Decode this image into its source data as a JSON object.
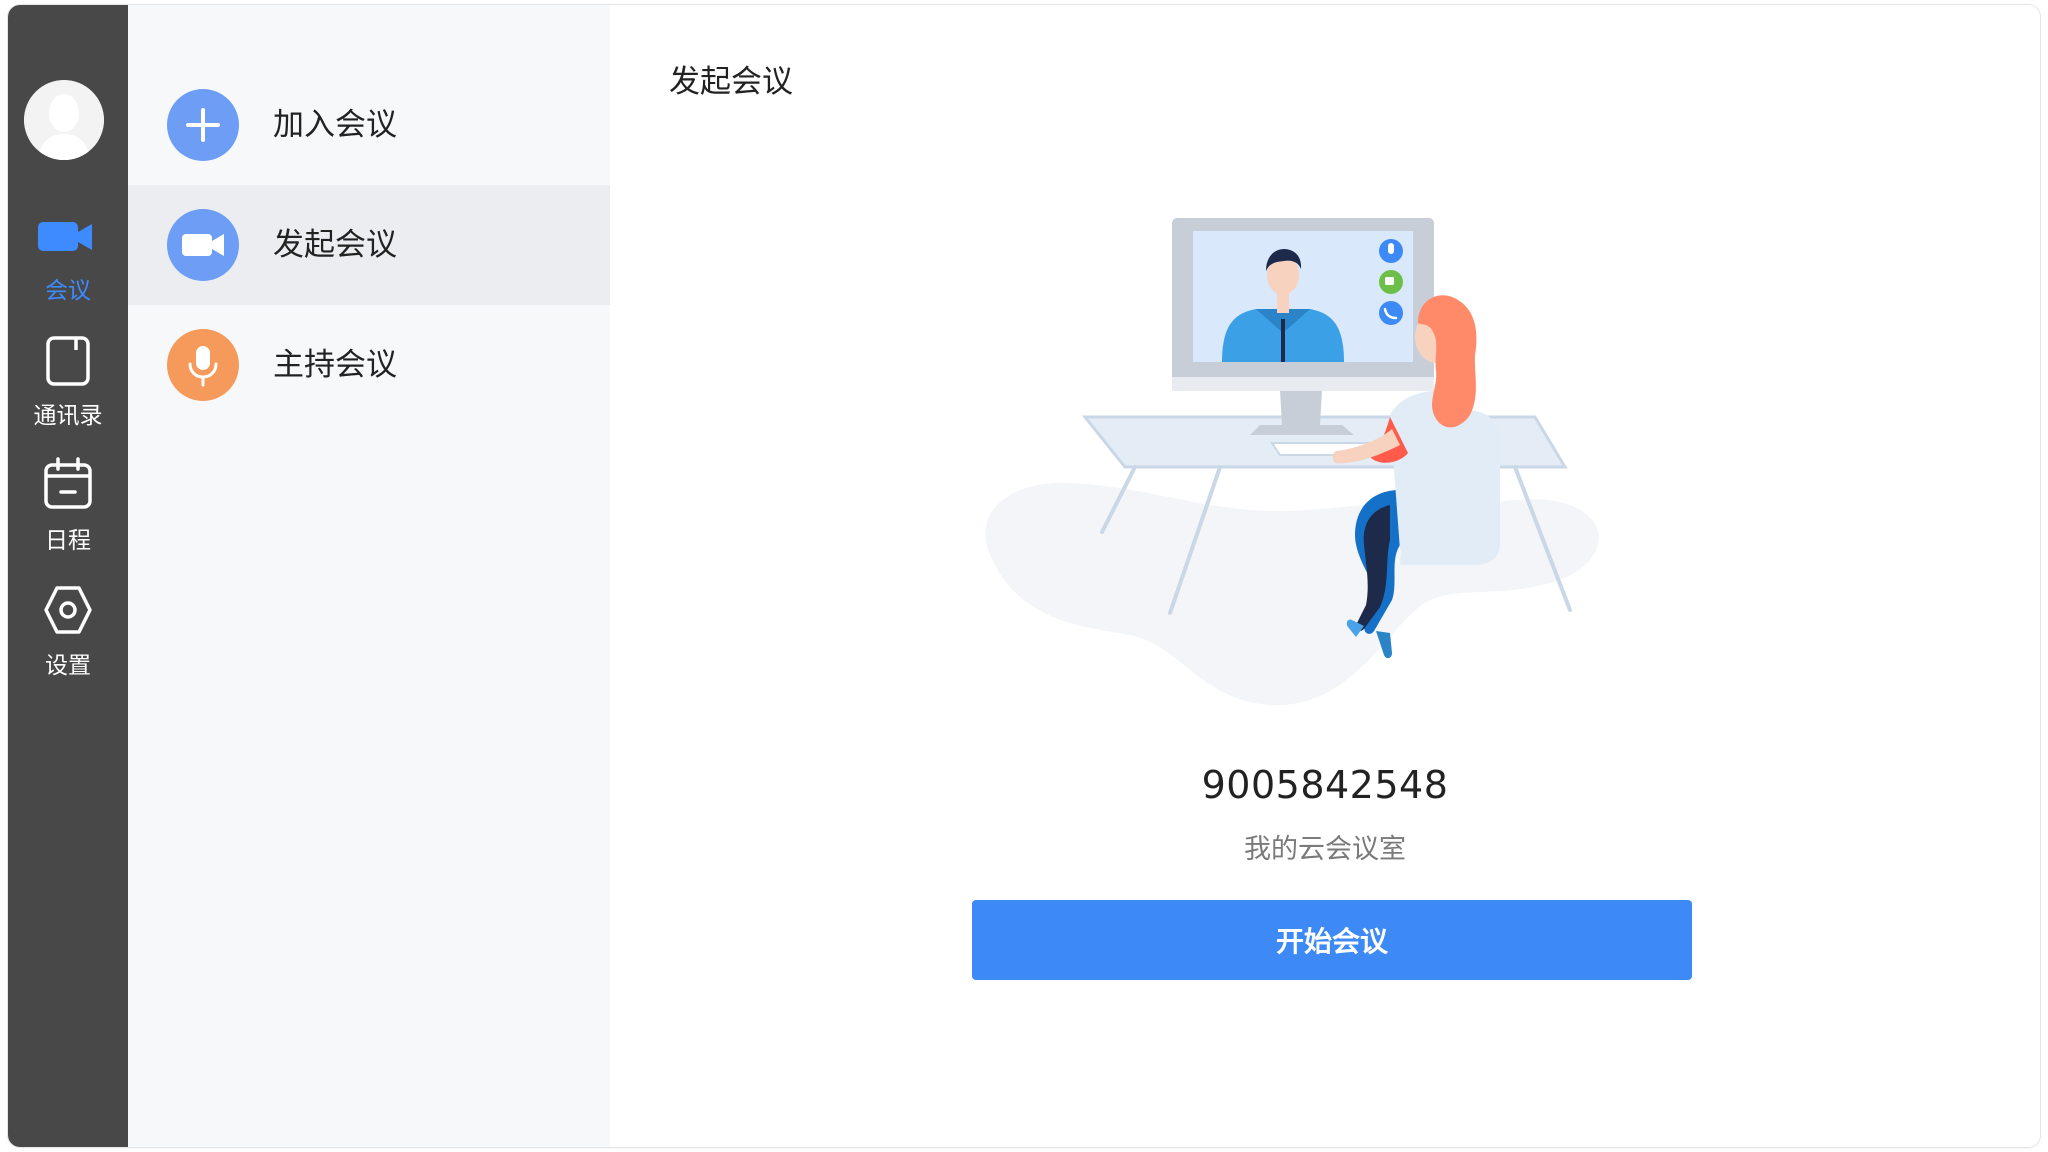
{
  "rail": {
    "items": [
      {
        "label": "会议",
        "icon": "video-camera-icon",
        "active": true
      },
      {
        "label": "通讯录",
        "icon": "contacts-book-icon",
        "active": false
      },
      {
        "label": "日程",
        "icon": "calendar-icon",
        "active": false
      },
      {
        "label": "设置",
        "icon": "settings-gear-icon",
        "active": false
      }
    ]
  },
  "menu": {
    "items": [
      {
        "label": "加入会议",
        "icon": "plus-icon",
        "color": "#6e9df6"
      },
      {
        "label": "发起会议",
        "icon": "video-camera-icon",
        "color": "#6e9df6",
        "active": true
      },
      {
        "label": "主持会议",
        "icon": "microphone-icon",
        "color": "#f59a5b"
      }
    ]
  },
  "main": {
    "title": "发起会议",
    "meeting_id": "9005842548",
    "room_name": "我的云会议室",
    "start_button": "开始会议"
  },
  "colors": {
    "rail_bg": "#484848",
    "accent": "#3d8af7",
    "active_rail_label": "#3d8bff",
    "menu_bg": "#f7f8fa",
    "menu_active_bg": "#ebedf0"
  }
}
